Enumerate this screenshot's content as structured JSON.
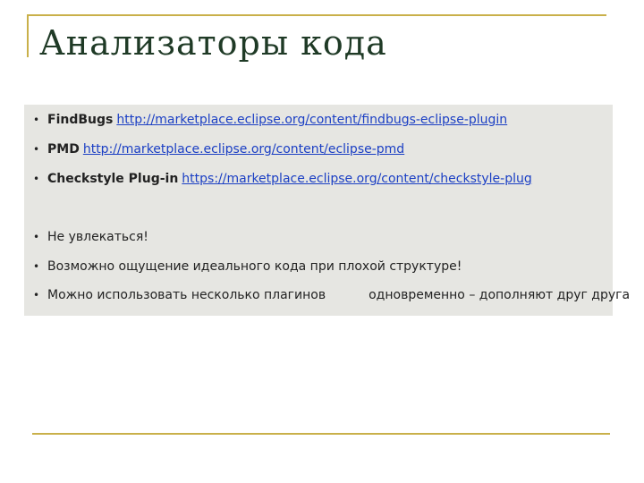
{
  "slide": {
    "title": "Анализаторы кода"
  },
  "content": {
    "bullet": "•",
    "items": [
      {
        "tool": "FindBugs",
        "link": "http://marketplace.eclipse.org/content/findbugs-eclipse-plugin"
      },
      {
        "tool": "PMD",
        "link": "http://marketplace.eclipse.org/content/eclipse-pmd"
      },
      {
        "tool": "Checkstyle Plug-in",
        "link": "https://marketplace.eclipse.org/content/checkstyle-plug"
      }
    ],
    "notes": [
      "Не увлекаться!",
      "Возможно ощущение идеального кода при плохой структуре!"
    ],
    "last_note": {
      "part1": "Можно использовать несколько плагинов",
      "part2": "одновременно – дополняют друг друга"
    }
  },
  "colors": {
    "frame": "#c9b04a",
    "title": "#1f3a26",
    "panel": "#e6e6e2",
    "link": "#1b3fc4"
  }
}
